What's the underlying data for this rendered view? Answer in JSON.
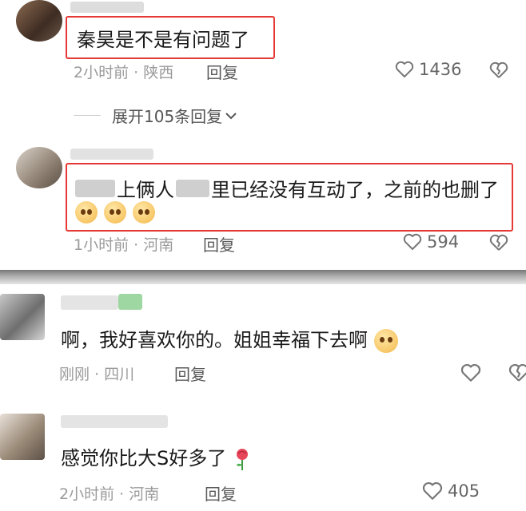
{
  "comments": [
    {
      "text": "秦昊是不是有问题了",
      "time": "2小时前",
      "location": "陕西",
      "reply": "回复",
      "likes": "1436"
    },
    {
      "text_a": "上俩人",
      "text_b": "里已经没有互动了，之前的也删了",
      "time": "1小时前",
      "location": "河南",
      "reply": "回复",
      "likes": "594"
    },
    {
      "text": "啊，我好喜欢你的。姐姐幸福下去啊",
      "time": "刚刚",
      "location": "四川",
      "reply": "回复"
    },
    {
      "text": "感觉你比大S好多了",
      "time": "2小时前",
      "location": "河南",
      "reply": "回复",
      "likes": "405"
    }
  ],
  "expand_replies": "展开105条回复",
  "sep": "·",
  "icons": {
    "like": "heart-outline-icon",
    "dislike": "broken-heart-icon",
    "expand": "chevron-down-icon",
    "rose": "rose-emoji",
    "emoji": "face-emoji"
  },
  "colors": {
    "highlight": "#e53935",
    "meta": "#9b9b9b"
  }
}
